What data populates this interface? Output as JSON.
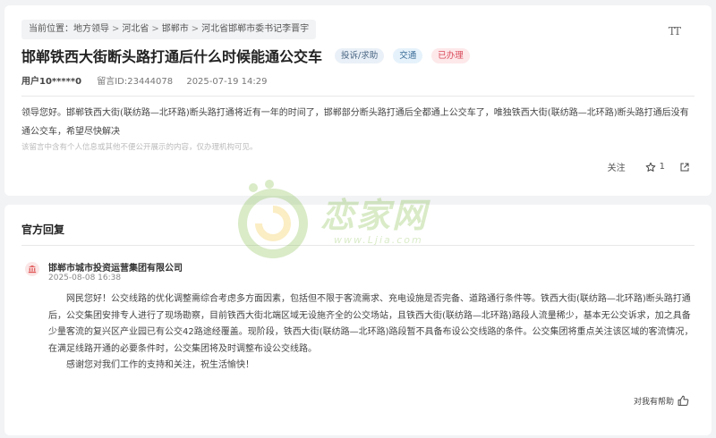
{
  "breadcrumb": {
    "prefix": "当前位置：",
    "items": [
      "地方领导",
      "河北省",
      "邯郸市",
      "河北省邯郸市委书记李晋宇"
    ],
    "separator": ">"
  },
  "font_size_toggle": {
    "label": "TT",
    "icon": "font-size-icon"
  },
  "question": {
    "title": "邯郸铁西大街断头路打通后什么时候能通公交车",
    "tags": [
      {
        "label": "投诉/求助",
        "color": "#4a6684"
      },
      {
        "label": "交通",
        "color": "#3d6e99"
      },
      {
        "label": "已办理",
        "color": "#d94c5c"
      }
    ],
    "user": "用户10*****0",
    "message_id": "留言ID:23444078",
    "datetime": "2025-07-19 14:29",
    "body": "领导您好。邯郸铁西大街(联纺路—北环路)断头路打通将近有一年的时间了，邯郸部分断头路打通后全都通上公交车了，唯独铁西大街(联纺路—北环路)断头路打通后没有通公交车，希望尽快解决",
    "notice": "该留言中含有个人信息或其他不便公开展示的内容，仅办理机构可见。",
    "follow_label": "关注",
    "star_count": "1"
  },
  "official_reply": {
    "section_title": "官方回复",
    "org_name": "邯郸市城市投资运营集团有限公司",
    "datetime": "2025-08-08 16:38",
    "paragraph1": "网民您好！公交线路的优化调整需综合考虑多方面因素，包括但不限于客流需求、充电设施是否完备、道路通行条件等。铁西大街(联纺路—北环路)断头路打通后，公交集团安排专人进行了现场勘察，目前铁西大街北端区域无设施齐全的公交场站，且铁西大街(联纺路—北环路)路段人流量稀少，基本无公交诉求，加之具备少量客流的复兴区产业园已有公交42路途经覆盖。现阶段，铁西大街(联纺路—北环路)路段暂不具备布设公交线路的条件。公交集团将重点关注该区域的客流情况，在满足线路开通的必要条件时，公交集团将及时调整布设公交线路。",
    "paragraph2": "感谢您对我们工作的支持和关注，祝生活愉快！",
    "helpful_label": "对我有帮助"
  },
  "watermark": {
    "text": "恋家网",
    "url": "www.Ljia.com"
  },
  "colors": {
    "background": "#f2f3f5",
    "card": "#ffffff",
    "watermark": "#79b93a"
  }
}
